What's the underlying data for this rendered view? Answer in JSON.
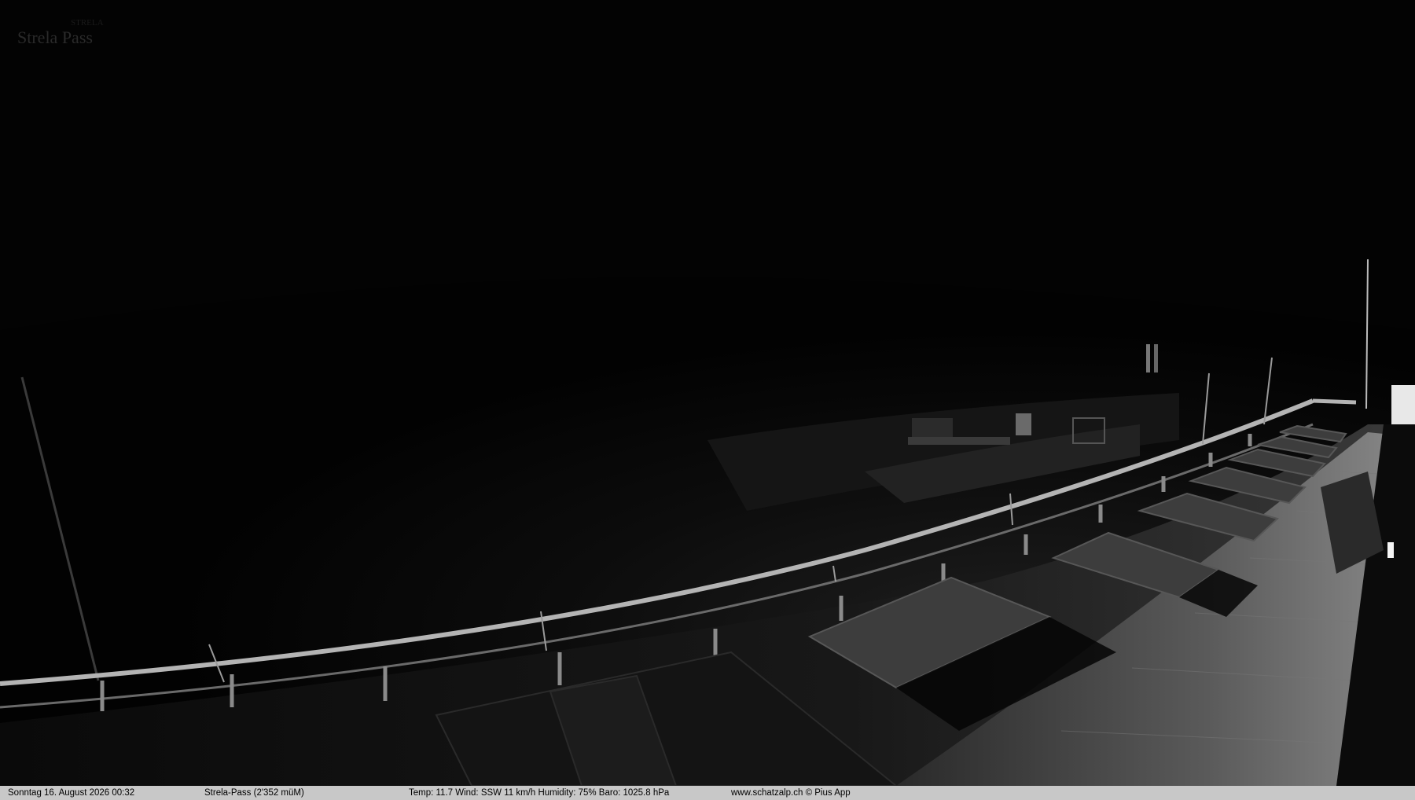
{
  "overlay": {
    "logo_text": "Strela Pass"
  },
  "status_bar": {
    "date_time": "Sonntag  16. August 2026  00:32",
    "location": "Strela-Pass (2'352 müM)",
    "weather": "Temp: 11.7  Wind: SSW 11 km/h  Humidity: 75%  Baro: 1025.8 hPa",
    "credit": "www.schatzalp.ch © Pius App"
  }
}
